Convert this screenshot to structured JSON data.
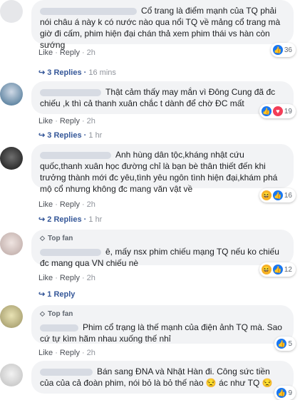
{
  "comments": [
    {
      "text": "Cổ trang là điểm mạnh của TQ phải nói châu á này k có nước nào qua nổi TQ về mảng cổ trang mà giờ đi cấm, phim hiện đại chán thả xem phim thái vs hàn còn sướng",
      "actions": {
        "like": "Like",
        "reply": "Reply",
        "time": "2h"
      },
      "reactions": {
        "icons": [
          "like-icon"
        ],
        "count": "36"
      },
      "replies": {
        "label": "3 Replies",
        "time": "16 mins"
      }
    },
    {
      "text": "Thật cảm thấy may mắn vì Đông Cung đã đc chiếu ,k thì cả thanh xuân chắc t dành để chờ ĐC mất",
      "actions": {
        "like": "Like",
        "reply": "Reply",
        "time": "2h"
      },
      "reactions": {
        "icons": [
          "like-icon",
          "love-icon"
        ],
        "count": "19"
      },
      "replies": {
        "label": "3 Replies",
        "time": "1 hr"
      }
    },
    {
      "text": "Anh hùng dân tộc,kháng nhật cứu quốc,thanh xuân học đường chỉ là bạn bè thân thiết đến khi trưởng thành mới đc yêu,tình yêu ngôn tình hiện đại,khám phá mộ cổ nhưng không đc mang văn vật về",
      "actions": {
        "like": "Like",
        "reply": "Reply",
        "time": "2h"
      },
      "reactions": {
        "icons": [
          "haha-icon",
          "like-icon"
        ],
        "count": "16"
      },
      "replies": {
        "label": "2 Replies",
        "time": "1 hr"
      }
    },
    {
      "top_fan": "Top fan",
      "text": "ê, mấy nsx phim chiếu mạng TQ nếu ko chiếu đc mang qua VN chiếu nè",
      "actions": {
        "like": "Like",
        "reply": "Reply",
        "time": "2h"
      },
      "reactions": {
        "icons": [
          "haha-icon",
          "like-icon"
        ],
        "count": "12"
      },
      "replies": {
        "label": "1 Reply",
        "time": ""
      }
    },
    {
      "top_fan": "Top fan",
      "text": "Phim cổ trạng là thế mạnh của điện ảnh TQ mà. Sao cứ tự kìm hãm nhau xuống thế nhỉ",
      "actions": {
        "like": "Like",
        "reply": "Reply",
        "time": "2h"
      },
      "reactions": {
        "icons": [
          "like-icon"
        ],
        "count": "5"
      },
      "replies": null
    },
    {
      "text": "Bán sang ĐNA và Nhật Hàn đi. Công sức tiền của của cả đoàn phim, nói bỏ là bỏ thế nào 😒 ác như TQ 😒",
      "actions": null,
      "reactions": {
        "icons": [
          "like-icon"
        ],
        "count": "9"
      },
      "replies": null
    }
  ]
}
